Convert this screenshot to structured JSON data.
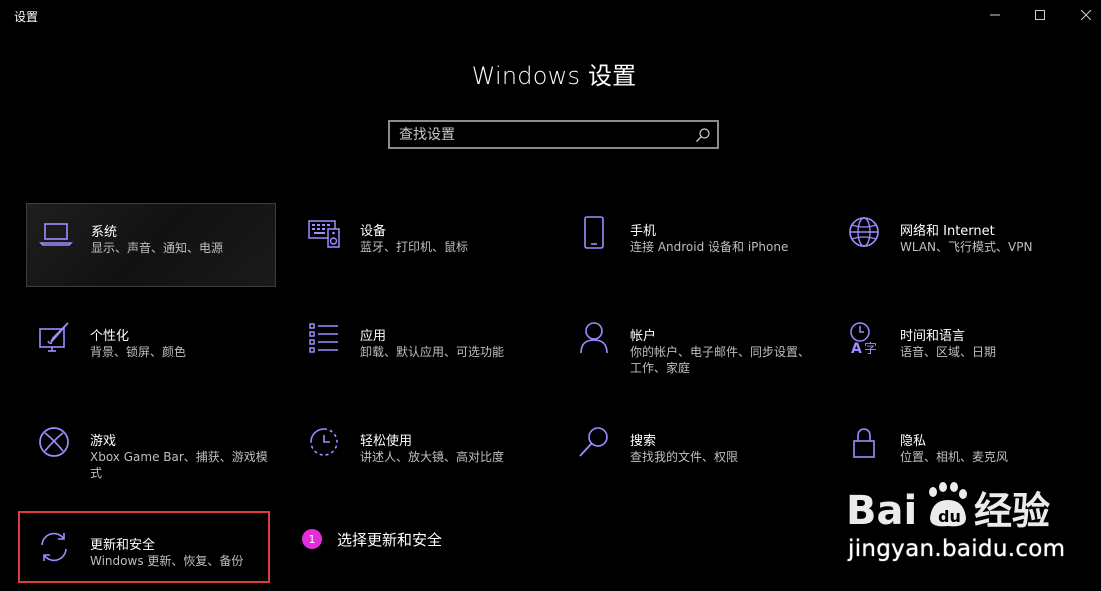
{
  "window": {
    "title": "设置",
    "controls": {
      "minimize": "minimize",
      "maximize": "maximize",
      "close": "close"
    }
  },
  "page_title": "Windows 设置",
  "search": {
    "placeholder": "查找设置",
    "value": "",
    "icon": "search-icon"
  },
  "colors": {
    "accent": "#9f8cff",
    "highlight_box": "#e03a3a",
    "step_badge": "#e22fd9"
  },
  "tiles": [
    {
      "id": "system",
      "icon": "laptop-icon",
      "label": "系统",
      "desc": "显示、声音、通知、电源",
      "selected": true
    },
    {
      "id": "devices",
      "icon": "keyboard-speaker-icon",
      "label": "设备",
      "desc": "蓝牙、打印机、鼠标"
    },
    {
      "id": "phone",
      "icon": "phone-icon",
      "label": "手机",
      "desc": "连接 Android 设备和 iPhone"
    },
    {
      "id": "network",
      "icon": "globe-icon",
      "label": "网络和 Internet",
      "desc": "WLAN、飞行模式、VPN"
    },
    {
      "id": "personalization",
      "icon": "paint-monitor-icon",
      "label": "个性化",
      "desc": "背景、锁屏、颜色"
    },
    {
      "id": "apps",
      "icon": "apps-list-icon",
      "label": "应用",
      "desc": "卸载、默认应用、可选功能"
    },
    {
      "id": "accounts",
      "icon": "person-icon",
      "label": "帐户",
      "desc": "你的帐户、电子邮件、同步设置、工作、家庭"
    },
    {
      "id": "time-language",
      "icon": "time-language-icon",
      "label": "时间和语言",
      "desc": "语音、区域、日期"
    },
    {
      "id": "gaming",
      "icon": "xbox-icon",
      "label": "游戏",
      "desc": "Xbox Game Bar、捕获、游戏模式"
    },
    {
      "id": "ease-of-access",
      "icon": "ease-of-access-icon",
      "label": "轻松使用",
      "desc": "讲述人、放大镜、高对比度"
    },
    {
      "id": "search",
      "icon": "magnifier-icon",
      "label": "搜索",
      "desc": "查找我的文件、权限"
    },
    {
      "id": "privacy",
      "icon": "lock-icon",
      "label": "隐私",
      "desc": "位置、相机、麦克风"
    },
    {
      "id": "update-security",
      "icon": "sync-icon",
      "label": "更新和安全",
      "desc": "Windows 更新、恢复、备份",
      "highlighted": true
    }
  ],
  "callout": {
    "number": "1",
    "text": "选择更新和安全"
  },
  "watermark": {
    "logo_text": "Baidu经验",
    "url": "jingyan.baidu.com"
  }
}
